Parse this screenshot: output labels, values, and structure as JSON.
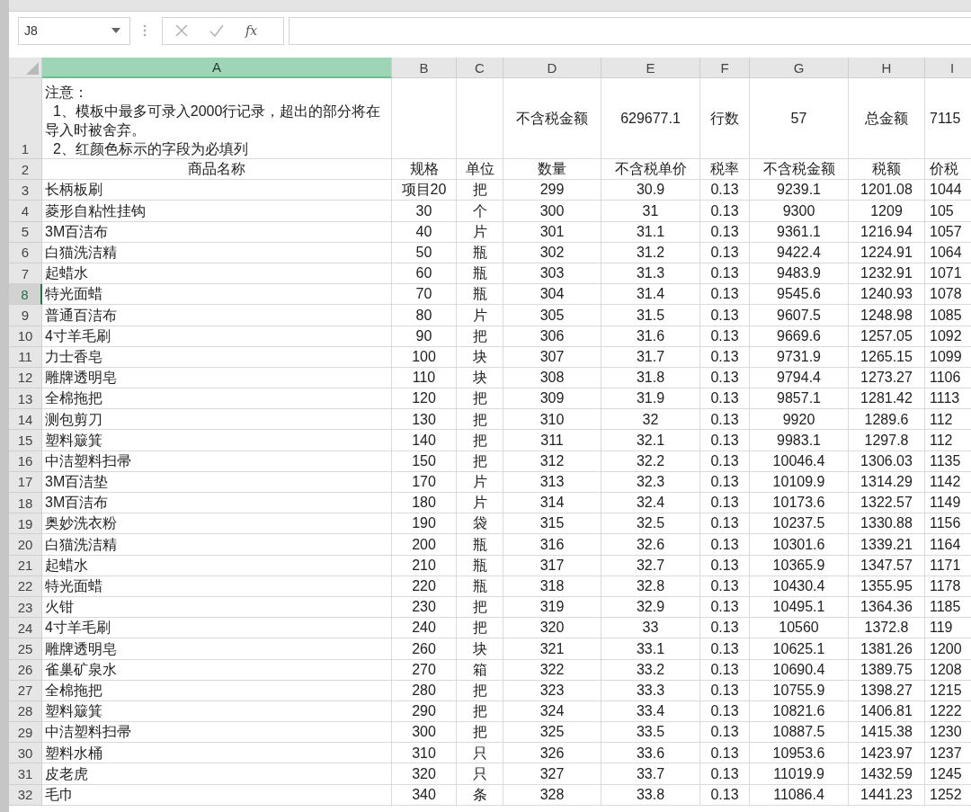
{
  "name_box": {
    "value": "J8"
  },
  "formula_bar": {
    "function_label": "fx"
  },
  "columns": [
    {
      "label": "A",
      "selected": true
    },
    {
      "label": "B",
      "selected": false
    },
    {
      "label": "C",
      "selected": false
    },
    {
      "label": "D",
      "selected": false
    },
    {
      "label": "E",
      "selected": false
    },
    {
      "label": "F",
      "selected": false
    },
    {
      "label": "G",
      "selected": false
    },
    {
      "label": "H",
      "selected": false
    },
    {
      "label": "I",
      "selected": false
    }
  ],
  "rows": [
    {
      "number": "1",
      "selected": false,
      "kind": "note",
      "note_lines": [
        "注意：",
        "  1、模板中最多可录入2000行记录，超出的部分将在导入时被舍弃。",
        "  2、红颜色标示的字段为必填列"
      ],
      "summary": [
        "不含税金额",
        "629677.1",
        "行数",
        "57",
        "总金额",
        "7115"
      ]
    },
    {
      "number": "2",
      "selected": false,
      "kind": "header",
      "cells": [
        "商品名称",
        "规格",
        "单位",
        "数量",
        "不含税单价",
        "税率",
        "不含税金额",
        "税额",
        "价税"
      ]
    },
    {
      "number": "3",
      "selected": false,
      "kind": "data",
      "cells": [
        "长柄板刷",
        "项目20",
        "把",
        "299",
        "30.9",
        "0.13",
        "9239.1",
        "1201.08",
        "1044"
      ]
    },
    {
      "number": "4",
      "selected": false,
      "kind": "data",
      "cells": [
        "菱形自粘性挂钩",
        "30",
        "个",
        "300",
        "31",
        "0.13",
        "9300",
        "1209",
        "105"
      ]
    },
    {
      "number": "5",
      "selected": false,
      "kind": "data",
      "cells": [
        "3M百洁布",
        "40",
        "片",
        "301",
        "31.1",
        "0.13",
        "9361.1",
        "1216.94",
        "1057"
      ]
    },
    {
      "number": "6",
      "selected": false,
      "kind": "data",
      "cells": [
        "白猫洗洁精",
        "50",
        "瓶",
        "302",
        "31.2",
        "0.13",
        "9422.4",
        "1224.91",
        "1064"
      ]
    },
    {
      "number": "7",
      "selected": false,
      "kind": "data",
      "cells": [
        "起蜡水",
        "60",
        "瓶",
        "303",
        "31.3",
        "0.13",
        "9483.9",
        "1232.91",
        "1071"
      ]
    },
    {
      "number": "8",
      "selected": true,
      "kind": "data",
      "cells": [
        "特光面蜡",
        "70",
        "瓶",
        "304",
        "31.4",
        "0.13",
        "9545.6",
        "1240.93",
        "1078"
      ]
    },
    {
      "number": "9",
      "selected": false,
      "kind": "data",
      "cells": [
        "普通百洁布",
        "80",
        "片",
        "305",
        "31.5",
        "0.13",
        "9607.5",
        "1248.98",
        "1085"
      ]
    },
    {
      "number": "10",
      "selected": false,
      "kind": "data",
      "cells": [
        "4寸羊毛刷",
        "90",
        "把",
        "306",
        "31.6",
        "0.13",
        "9669.6",
        "1257.05",
        "1092"
      ]
    },
    {
      "number": "11",
      "selected": false,
      "kind": "data",
      "cells": [
        "力士香皂",
        "100",
        "块",
        "307",
        "31.7",
        "0.13",
        "9731.9",
        "1265.15",
        "1099"
      ]
    },
    {
      "number": "12",
      "selected": false,
      "kind": "data",
      "cells": [
        "雕牌透明皂",
        "110",
        "块",
        "308",
        "31.8",
        "0.13",
        "9794.4",
        "1273.27",
        "1106"
      ]
    },
    {
      "number": "13",
      "selected": false,
      "kind": "data",
      "cells": [
        "全棉拖把",
        "120",
        "把",
        "309",
        "31.9",
        "0.13",
        "9857.1",
        "1281.42",
        "1113"
      ]
    },
    {
      "number": "14",
      "selected": false,
      "kind": "data",
      "cells": [
        "测包剪刀",
        "130",
        "把",
        "310",
        "32",
        "0.13",
        "9920",
        "1289.6",
        "112"
      ]
    },
    {
      "number": "15",
      "selected": false,
      "kind": "data",
      "cells": [
        "塑料簸箕",
        "140",
        "把",
        "311",
        "32.1",
        "0.13",
        "9983.1",
        "1297.8",
        "112"
      ]
    },
    {
      "number": "16",
      "selected": false,
      "kind": "data",
      "cells": [
        "中洁塑料扫帚",
        "150",
        "把",
        "312",
        "32.2",
        "0.13",
        "10046.4",
        "1306.03",
        "1135"
      ]
    },
    {
      "number": "17",
      "selected": false,
      "kind": "data",
      "cells": [
        "3M百洁垫",
        "170",
        "片",
        "313",
        "32.3",
        "0.13",
        "10109.9",
        "1314.29",
        "1142"
      ]
    },
    {
      "number": "18",
      "selected": false,
      "kind": "data",
      "cells": [
        "3M百洁布",
        "180",
        "片",
        "314",
        "32.4",
        "0.13",
        "10173.6",
        "1322.57",
        "1149"
      ]
    },
    {
      "number": "19",
      "selected": false,
      "kind": "data",
      "cells": [
        "奥妙洗衣粉",
        "190",
        "袋",
        "315",
        "32.5",
        "0.13",
        "10237.5",
        "1330.88",
        "1156"
      ]
    },
    {
      "number": "20",
      "selected": false,
      "kind": "data",
      "cells": [
        "白猫洗洁精",
        "200",
        "瓶",
        "316",
        "32.6",
        "0.13",
        "10301.6",
        "1339.21",
        "1164"
      ]
    },
    {
      "number": "21",
      "selected": false,
      "kind": "data",
      "cells": [
        "起蜡水",
        "210",
        "瓶",
        "317",
        "32.7",
        "0.13",
        "10365.9",
        "1347.57",
        "1171"
      ]
    },
    {
      "number": "22",
      "selected": false,
      "kind": "data",
      "cells": [
        "特光面蜡",
        "220",
        "瓶",
        "318",
        "32.8",
        "0.13",
        "10430.4",
        "1355.95",
        "1178"
      ]
    },
    {
      "number": "23",
      "selected": false,
      "kind": "data",
      "cells": [
        "火钳",
        "230",
        "把",
        "319",
        "32.9",
        "0.13",
        "10495.1",
        "1364.36",
        "1185"
      ]
    },
    {
      "number": "24",
      "selected": false,
      "kind": "data",
      "cells": [
        "4寸羊毛刷",
        "240",
        "把",
        "320",
        "33",
        "0.13",
        "10560",
        "1372.8",
        "119"
      ]
    },
    {
      "number": "25",
      "selected": false,
      "kind": "data",
      "cells": [
        "雕牌透明皂",
        "260",
        "块",
        "321",
        "33.1",
        "0.13",
        "10625.1",
        "1381.26",
        "1200"
      ]
    },
    {
      "number": "26",
      "selected": false,
      "kind": "data",
      "cells": [
        "雀巢矿泉水",
        "270",
        "箱",
        "322",
        "33.2",
        "0.13",
        "10690.4",
        "1389.75",
        "1208"
      ]
    },
    {
      "number": "27",
      "selected": false,
      "kind": "data",
      "cells": [
        "全棉拖把",
        "280",
        "把",
        "323",
        "33.3",
        "0.13",
        "10755.9",
        "1398.27",
        "1215"
      ]
    },
    {
      "number": "28",
      "selected": false,
      "kind": "data",
      "cells": [
        "塑料簸箕",
        "290",
        "把",
        "324",
        "33.4",
        "0.13",
        "10821.6",
        "1406.81",
        "1222"
      ]
    },
    {
      "number": "29",
      "selected": false,
      "kind": "data",
      "cells": [
        "中洁塑料扫帚",
        "300",
        "把",
        "325",
        "33.5",
        "0.13",
        "10887.5",
        "1415.38",
        "1230"
      ]
    },
    {
      "number": "30",
      "selected": false,
      "kind": "data",
      "cells": [
        "塑料水桶",
        "310",
        "只",
        "326",
        "33.6",
        "0.13",
        "10953.6",
        "1423.97",
        "1237"
      ]
    },
    {
      "number": "31",
      "selected": false,
      "kind": "data",
      "cells": [
        "皮老虎",
        "320",
        "只",
        "327",
        "33.7",
        "0.13",
        "11019.9",
        "1432.59",
        "1245"
      ]
    },
    {
      "number": "32",
      "selected": false,
      "kind": "data",
      "cells": [
        "毛巾",
        "340",
        "条",
        "328",
        "33.8",
        "0.13",
        "11086.4",
        "1441.23",
        "1252"
      ]
    }
  ]
}
